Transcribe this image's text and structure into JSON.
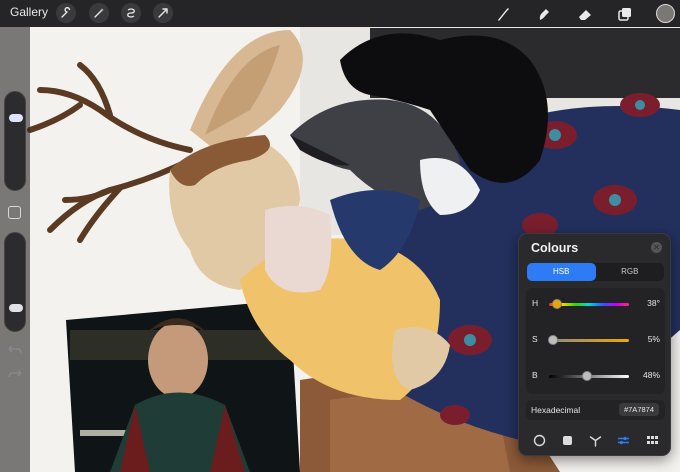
{
  "topbar": {
    "gallery_label": "Gallery",
    "left_tools": [
      "wrench-icon",
      "magic-wand-icon",
      "selection-icon",
      "transform-icon"
    ],
    "right_tools": [
      "brush-icon",
      "smudge-icon",
      "eraser-icon",
      "layers-icon"
    ],
    "current_color": "#7A7874"
  },
  "sidebar": {
    "size_slider_level": 0.24,
    "opacity_slider_level": 0.77
  },
  "colours_panel": {
    "title": "Colours",
    "modes": [
      "HSB",
      "RGB"
    ],
    "active_mode": "HSB",
    "hue": {
      "label": "H",
      "value": "38°",
      "level": 0.106
    },
    "saturation": {
      "label": "S",
      "value": "5%",
      "level": 0.05
    },
    "brightness": {
      "label": "B",
      "value": "48%",
      "level": 0.48
    },
    "hex_label": "Hexadecimal",
    "hex_value": "#7A7874",
    "bottom_tabs": [
      "disc-icon",
      "classic-icon",
      "harmony-icon",
      "value-icon",
      "palettes-icon"
    ],
    "accent": "#2D7CF6"
  }
}
